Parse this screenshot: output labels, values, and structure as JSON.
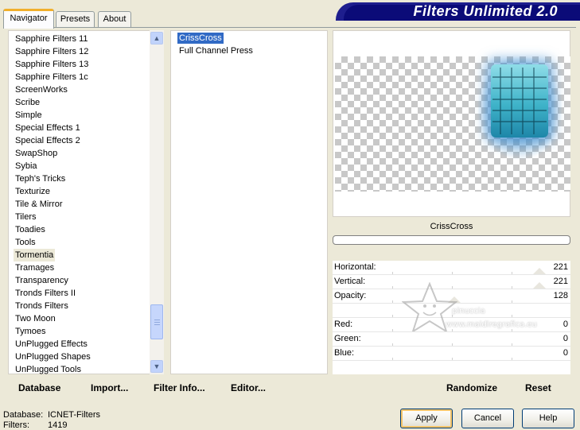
{
  "tabs": [
    {
      "label": "Navigator",
      "active": true
    },
    {
      "label": "Presets",
      "active": false
    },
    {
      "label": "About",
      "active": false
    }
  ],
  "banner": {
    "title": "Filters Unlimited 2.0"
  },
  "categories": {
    "items": [
      "Sapphire Filters 11",
      "Sapphire Filters 12",
      "Sapphire Filters 13",
      "Sapphire Filters 1c",
      "ScreenWorks",
      "Scribe",
      "Simple",
      "Special Effects 1",
      "Special Effects 2",
      "SwapShop",
      "Sybia",
      "Teph's Tricks",
      "Texturize",
      "Tile & Mirror",
      "Tilers",
      "Toadies",
      "Tools",
      "Tormentia",
      "Tramages",
      "Transparency",
      "Tronds Filters II",
      "Tronds Filters",
      "Two Moon",
      "Tymoes",
      "UnPlugged Effects",
      "UnPlugged Shapes",
      "UnPlugged Tools"
    ],
    "selected": "Tormentia"
  },
  "filters": {
    "items": [
      "CrissCross",
      "Full Channel Press"
    ],
    "selected": "CrissCross"
  },
  "preview": {
    "filter_name": "CrissCross"
  },
  "params": [
    {
      "label": "Horizontal:",
      "value": "221"
    },
    {
      "label": "Vertical:",
      "value": "221"
    },
    {
      "label": "Opacity:",
      "value": "128"
    },
    {
      "label": "",
      "value": ""
    },
    {
      "label": "Red:",
      "value": "0"
    },
    {
      "label": "Green:",
      "value": "0"
    },
    {
      "label": "Blue:",
      "value": "0"
    }
  ],
  "watermark": {
    "line1": "pinuccia",
    "line2": "www.maidiregrafica.eu"
  },
  "left_toolbar": {
    "database": "Database",
    "import": "Import...",
    "filter_info": "Filter Info...",
    "editor": "Editor..."
  },
  "right_toolbar": {
    "randomize": "Randomize",
    "reset": "Reset"
  },
  "status": {
    "database_label": "Database:",
    "database_value": "ICNET-Filters",
    "filters_label": "Filters:",
    "filters_value": "1419"
  },
  "buttons": {
    "apply": "Apply",
    "cancel": "Cancel",
    "help": "Help"
  },
  "colors": {
    "accent": "#316ac5",
    "banner": "#0b0b78",
    "tab_highlight": "#f1b02c"
  }
}
